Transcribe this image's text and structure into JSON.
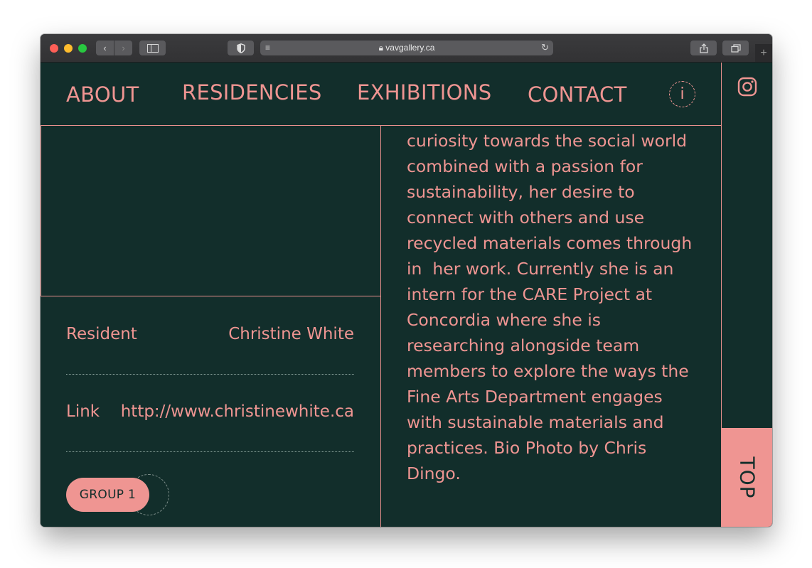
{
  "browser": {
    "url": "vavgallery.ca",
    "icons": [
      "back-icon",
      "forward-icon",
      "sidebar-icon",
      "shield-icon",
      "reader-icon",
      "lock-icon",
      "reload-icon",
      "share-icon",
      "tabs-icon",
      "new-tab-icon"
    ]
  },
  "nav": {
    "items": [
      {
        "label": "ABOUT"
      },
      {
        "label": "RESIDENCIES"
      },
      {
        "label": "EXHIBITIONS"
      },
      {
        "label": "CONTACT"
      }
    ],
    "info_label": "i"
  },
  "rail": {
    "top_label": "TOP"
  },
  "resident": {
    "label": "Resident",
    "name": "Christine White",
    "link_label": "Link",
    "link_url": "http://www.christinewhite.ca",
    "group_label": "GROUP 1"
  },
  "bio": {
    "lines": [
      "curiosity towards the social world",
      "combined with a passion for",
      "sustainability, her desire to",
      "connect with others and use",
      "recycled materials comes through",
      "in  her work. Currently she is an",
      "intern for the CARE Project at",
      "Concordia where she is",
      "researching alongside team",
      "members to explore the ways the",
      "Fine Arts Department engages",
      "with sustainable materials and",
      "practices. Bio Photo by Chris",
      "Dingo."
    ]
  },
  "colors": {
    "background": "#122e2b",
    "accent": "#ef9592"
  }
}
